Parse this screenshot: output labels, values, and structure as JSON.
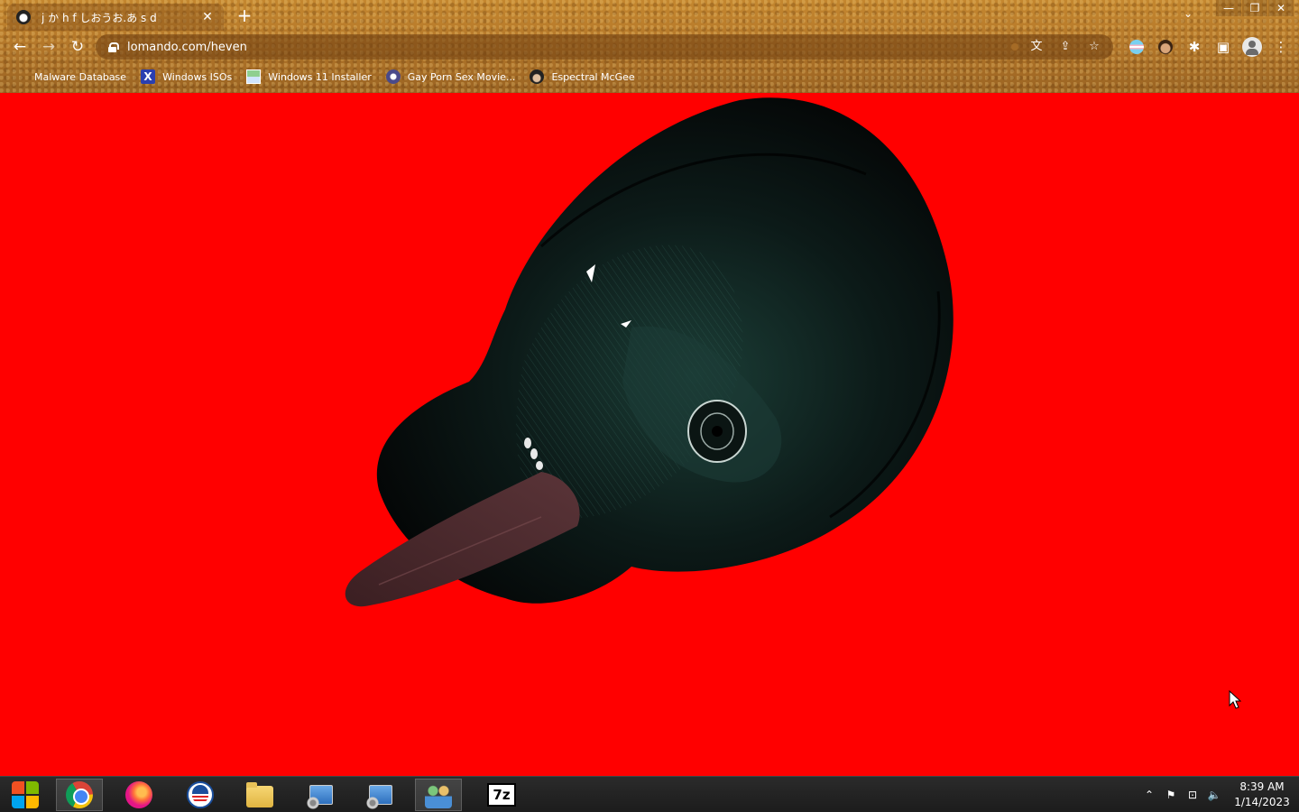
{
  "tab": {
    "title": "j か h f しおうお.あ s d",
    "close_glyph": "✕",
    "new_tab_glyph": "+"
  },
  "tab_search_glyph": "⌄",
  "window_controls": {
    "minimize": "—",
    "restore": "❐",
    "close": "✕"
  },
  "toolbar": {
    "back_glyph": "←",
    "forward_glyph": "→",
    "reload_glyph": "↻",
    "url": "lomando.com/heven",
    "translate_glyph": "文",
    "share_glyph": "⇪",
    "star_glyph": "☆",
    "extensions_glyph": "✱",
    "sidepanel_glyph": "▣",
    "menu_glyph": "⋮"
  },
  "bookmarks": [
    {
      "label": "Malware Database",
      "icon": "bookmark-icon"
    },
    {
      "label": "Windows ISOs",
      "icon": "x-icon"
    },
    {
      "label": "Windows 11 Installer",
      "icon": "image-icon"
    },
    {
      "label": "Gay Porn Sex Movie...",
      "icon": "globe-icon"
    },
    {
      "label": "Espectral McGee",
      "icon": "face-icon"
    }
  ],
  "taskbar": {
    "sevenzip_label": "7z",
    "tray_up_glyph": "⌃",
    "tray_flag_glyph": "⚑",
    "tray_network_glyph": "⊡",
    "tray_volume_glyph": "🔈",
    "time": "8:39 AM",
    "date": "1/14/2023"
  },
  "colors": {
    "page_background": "#ff0000",
    "chrome_theme": "#b5782a",
    "taskbar": "#222222"
  }
}
